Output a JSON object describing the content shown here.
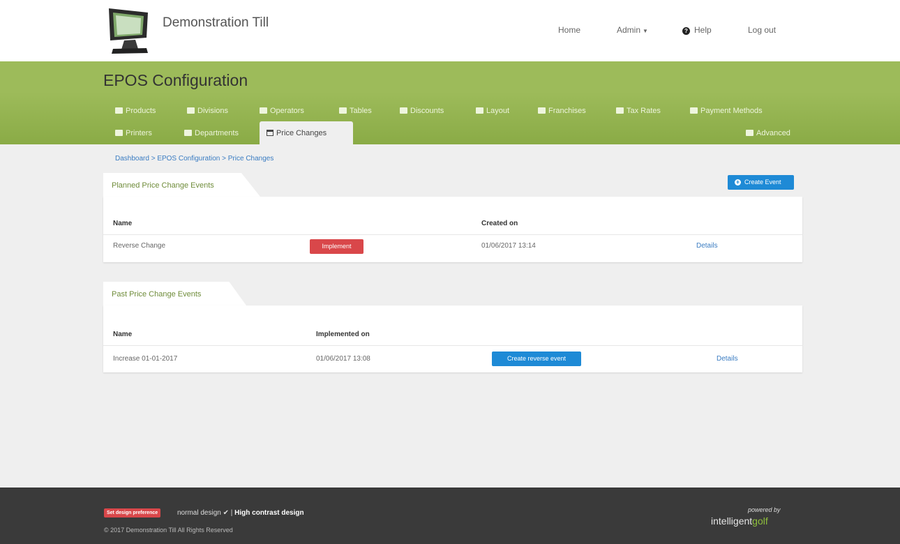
{
  "header": {
    "title": "Demonstration Till",
    "nav": {
      "home": "Home",
      "admin": "Admin",
      "help": "Help",
      "logout": "Log out"
    }
  },
  "config": {
    "title": "EPOS Configuration",
    "nav_row1": [
      "Products",
      "Divisions",
      "Operators",
      "Tables",
      "Discounts",
      "Layout",
      "Franchises",
      "Tax Rates",
      "Payment Methods"
    ],
    "nav_row2": [
      "Printers",
      "Departments",
      "Price Changes"
    ],
    "advanced": "Advanced",
    "active_tab": "Price Changes"
  },
  "breadcrumb": "Dashboard > EPOS Configuration > Price Changes",
  "planned": {
    "heading": "Planned Price Change Events",
    "create_label": "Create Event",
    "col_name": "Name",
    "col_created": "Created on",
    "row": {
      "name": "Reverse Change",
      "action": "Implement",
      "created": "01/06/2017 13:14",
      "details": "Details"
    }
  },
  "past": {
    "heading": "Past Price Change Events",
    "col_name": "Name",
    "col_implemented": "Implemented on",
    "row": {
      "name": "Increase 01-01-2017",
      "implemented": "01/06/2017 13:08",
      "action": "Create reverse event",
      "details": "Details"
    }
  },
  "footer": {
    "pref_badge": "Set design preference",
    "normal_design": "normal design",
    "high_contrast": "High contrast design",
    "copyright": "© 2017 Demonstration Till All Rights Reserved",
    "powered_by": "powered by",
    "brand_a": "intelligent",
    "brand_b": "golf"
  },
  "colors": {
    "green_band": "#9dbb5a",
    "accent_blue": "#1e8ad6",
    "accent_red": "#d9474a",
    "footer": "#3a3a3a"
  }
}
